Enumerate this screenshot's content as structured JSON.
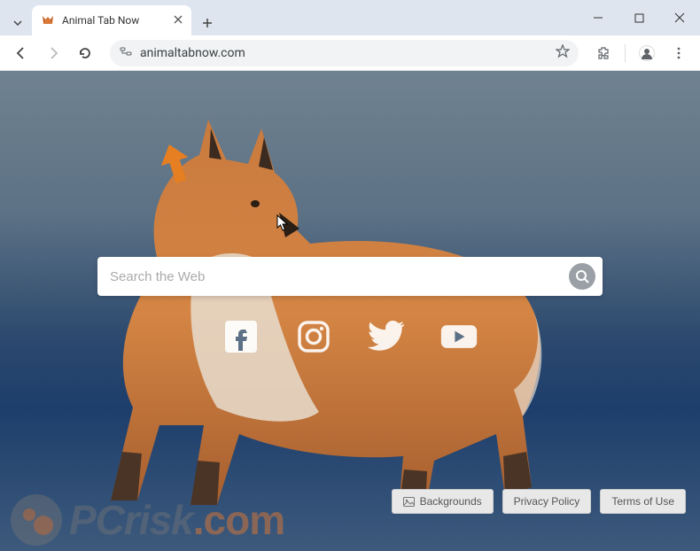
{
  "browser": {
    "tab_title": "Animal Tab Now",
    "url": "animaltabnow.com"
  },
  "search": {
    "placeholder": "Search the Web"
  },
  "social": {
    "facebook": "facebook-icon",
    "instagram": "instagram-icon",
    "twitter": "twitter-icon",
    "youtube": "youtube-icon"
  },
  "footer": {
    "backgrounds": "Backgrounds",
    "privacy": "Privacy Policy",
    "terms": "Terms of Use"
  },
  "watermark": {
    "text_pc": "PC",
    "text_risk": "risk",
    "text_com": ".com"
  }
}
